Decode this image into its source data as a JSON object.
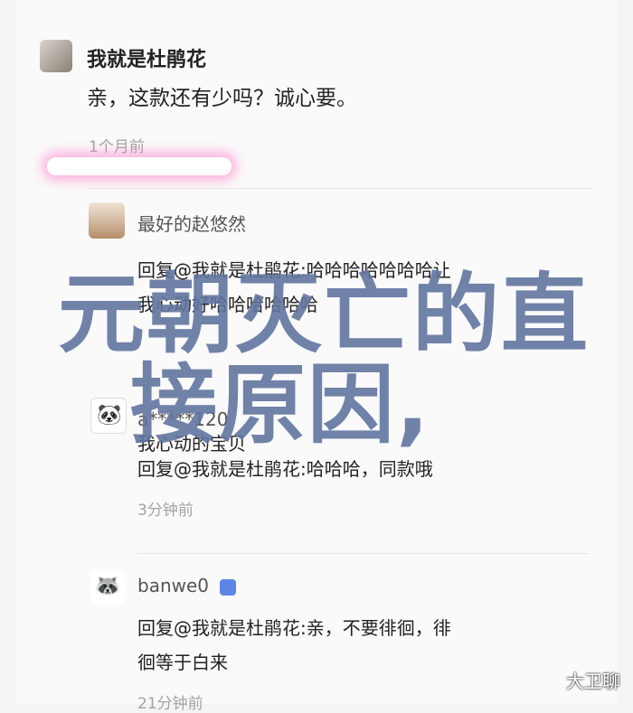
{
  "comments": [
    {
      "user": "我就是杜鹃花",
      "text": "亲，这款还有少吗？诚心要。",
      "time": "1个月前"
    },
    {
      "user": "最好的赵悠然",
      "text": "回复@我就是杜鹃花:哈哈哈哈哈哈哈让",
      "text2": "我心动好哈哈哈哈哈哈"
    },
    {
      "user": "a*****120",
      "text_partial": "我心动的宝贝",
      "text": "回复@我就是杜鹃花:哈哈哈，同款哦",
      "time": "3分钟前"
    },
    {
      "user": "banwe0",
      "text": "回复@我就是杜鹃花:亲，不要徘徊，徘",
      "text2": "徊等于白来",
      "time": "21分钟前"
    }
  ],
  "overlay": {
    "line1": "元朝灭亡的直",
    "line2": "接原因,"
  },
  "watermark": "大卫聊"
}
